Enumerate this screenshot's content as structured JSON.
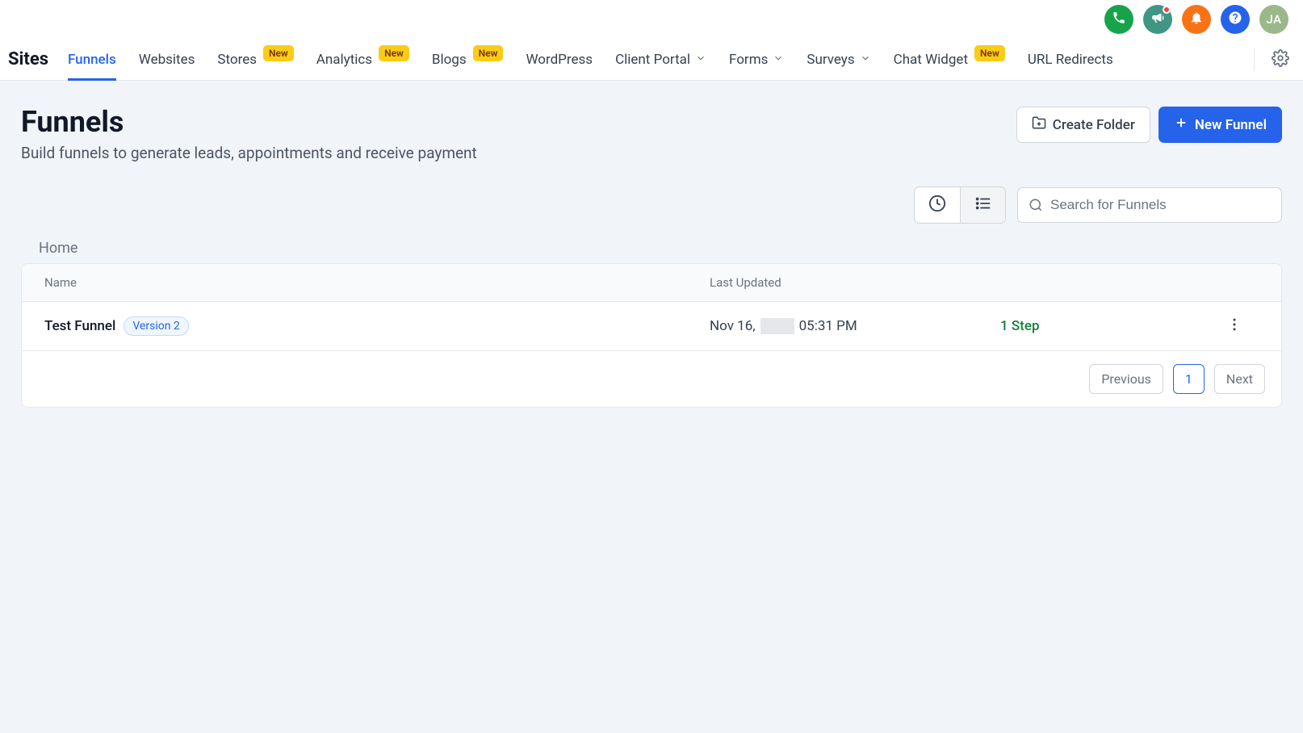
{
  "topbar": {
    "avatar_initials": "JA"
  },
  "nav": {
    "brand": "Sites",
    "items": [
      {
        "label": "Funnels",
        "active": true
      },
      {
        "label": "Websites"
      },
      {
        "label": "Stores",
        "badge": "New"
      },
      {
        "label": "Analytics",
        "badge": "New"
      },
      {
        "label": "Blogs",
        "badge": "New"
      },
      {
        "label": "WordPress"
      },
      {
        "label": "Client Portal",
        "dropdown": true
      },
      {
        "label": "Forms",
        "dropdown": true
      },
      {
        "label": "Surveys",
        "dropdown": true
      },
      {
        "label": "Chat Widget",
        "badge": "New"
      },
      {
        "label": "URL Redirects"
      }
    ]
  },
  "page": {
    "title": "Funnels",
    "subtitle": "Build funnels to generate leads, appointments and receive payment"
  },
  "actions": {
    "create_folder": "Create Folder",
    "new_funnel": "New Funnel"
  },
  "search": {
    "placeholder": "Search for Funnels"
  },
  "breadcrumb": {
    "home": "Home"
  },
  "table": {
    "columns": {
      "name": "Name",
      "updated": "Last Updated"
    },
    "rows": [
      {
        "name": "Test Funnel",
        "version": "Version 2",
        "date_prefix": "Nov 16,",
        "time": "05:31 PM",
        "steps": "1 Step"
      }
    ]
  },
  "pagination": {
    "prev": "Previous",
    "page": "1",
    "next": "Next"
  }
}
